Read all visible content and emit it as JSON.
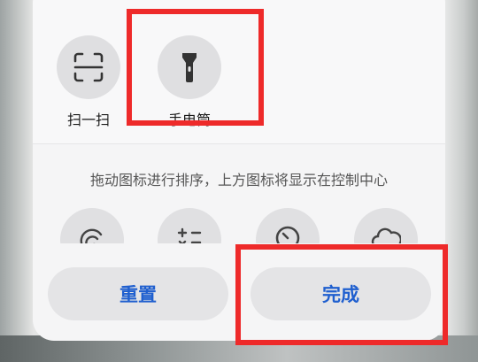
{
  "panel": {
    "tiles": [
      {
        "label": "扫一扫",
        "icon": "scan-icon"
      },
      {
        "label": "手电筒",
        "icon": "flashlight-icon"
      }
    ],
    "hint": "拖动图标进行排序，上方图标将显示在控制中心",
    "candidate_icons": [
      "nfc-icon",
      "calculator-icon",
      "timer-icon",
      "weather-icon"
    ]
  },
  "buttons": {
    "reset": "重置",
    "done": "完成"
  },
  "colors": {
    "accent": "#1f5fcf",
    "highlight": "#ee2a2a"
  }
}
